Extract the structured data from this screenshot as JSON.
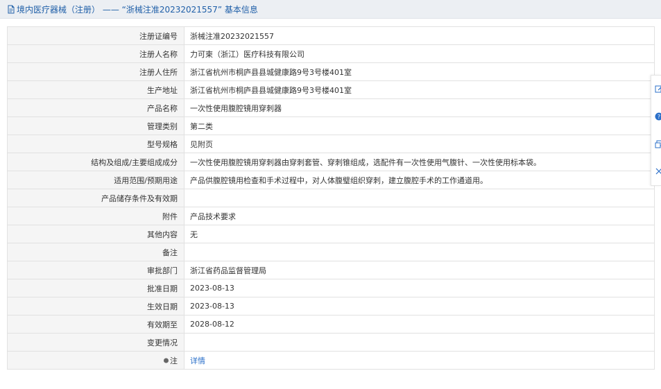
{
  "header": {
    "title": "境内医疗器械（注册） —— “浙械注准20232021557” 基本信息",
    "icon": "document-icon"
  },
  "rows": [
    {
      "label": "注册证编号",
      "value": "浙械注准20232021557"
    },
    {
      "label": "注册人名称",
      "value": "力可柬（浙江）医疗科技有限公司"
    },
    {
      "label": "注册人住所",
      "value": "浙江省杭州市桐庐县县城健康路9号3号楼401室"
    },
    {
      "label": "生产地址",
      "value": "浙江省杭州市桐庐县县城健康路9号3号楼401室"
    },
    {
      "label": "产品名称",
      "value": "一次性使用腹腔镜用穿刺器"
    },
    {
      "label": "管理类别",
      "value": "第二类"
    },
    {
      "label": "型号规格",
      "value": "见附页"
    },
    {
      "label": "结构及组成/主要组成成分",
      "value": "一次性使用腹腔镜用穿刺器由穿刺套管、穿刺锥组成，选配件有一次性使用气腹针、一次性使用标本袋。"
    },
    {
      "label": "适用范围/预期用途",
      "value": "产品供腹腔镜用检查和手术过程中，对人体腹璧组织穿刺，建立腹腔手术的工作通道用。"
    },
    {
      "label": "产品储存条件及有效期",
      "value": ""
    },
    {
      "label": "附件",
      "value": "产品技术要求"
    },
    {
      "label": "其他内容",
      "value": "无"
    },
    {
      "label": "备注",
      "value": ""
    },
    {
      "label": "审批部门",
      "value": "浙江省药品监督管理局"
    },
    {
      "label": "批准日期",
      "value": "2023-08-13"
    },
    {
      "label": "生效日期",
      "value": "2023-08-13"
    },
    {
      "label": "有效期至",
      "value": "2028-08-12"
    },
    {
      "label": "变更情况",
      "value": ""
    }
  ],
  "note_row": {
    "label": "注",
    "link_text": "详情",
    "icon": "pin-icon"
  },
  "side_panel": {
    "buttons": [
      "edit-icon",
      "help-icon",
      "copy-icon",
      "close-icon"
    ]
  },
  "colors": {
    "title": "#1f5fa8",
    "link": "#2a6fc9",
    "label_bg": "#f5f5f5",
    "header_bg": "#eceff3"
  }
}
